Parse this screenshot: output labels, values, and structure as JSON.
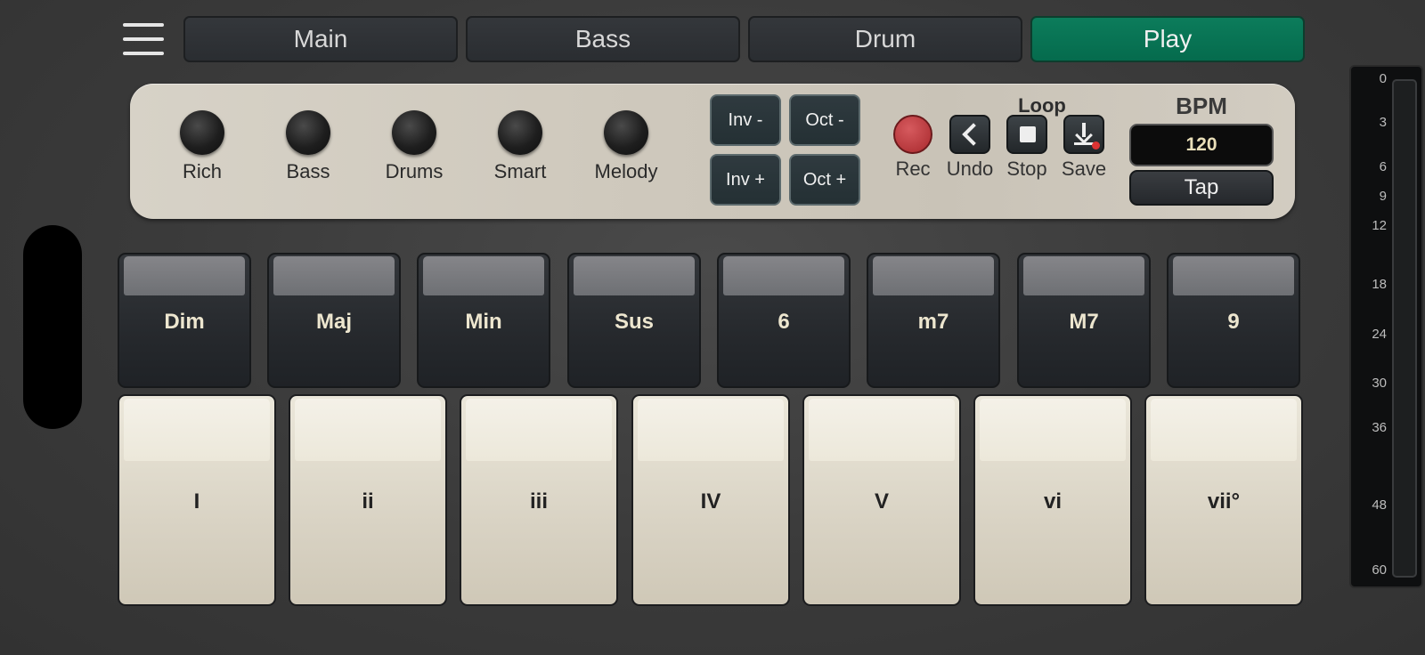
{
  "tabs": [
    {
      "label": "Main",
      "active": false
    },
    {
      "label": "Bass",
      "active": false
    },
    {
      "label": "Drum",
      "active": false
    },
    {
      "label": "Play",
      "active": true
    }
  ],
  "knobs": [
    "Rich",
    "Bass",
    "Drums",
    "Smart",
    "Melody"
  ],
  "inversion": {
    "minus": "Inv -",
    "plus": "Inv +"
  },
  "octave": {
    "minus": "Oct -",
    "plus": "Oct +"
  },
  "loop": {
    "title": "Loop",
    "rec": "Rec",
    "undo": "Undo",
    "stop": "Stop",
    "save": "Save"
  },
  "bpm": {
    "title": "BPM",
    "value": "120",
    "tap": "Tap"
  },
  "chord_types": [
    "Dim",
    "Maj",
    "Min",
    "Sus",
    "6",
    "m7",
    "M7",
    "9"
  ],
  "degrees": [
    "I",
    "ii",
    "iii",
    "IV",
    "V",
    "vi",
    "vii°"
  ],
  "meter": {
    "ticks": [
      "0",
      "3",
      "6",
      "9",
      "12",
      "18",
      "24",
      "30",
      "36",
      "48",
      "60"
    ]
  },
  "colors": {
    "play_tab": "#067456",
    "rec": "#b8393c"
  }
}
